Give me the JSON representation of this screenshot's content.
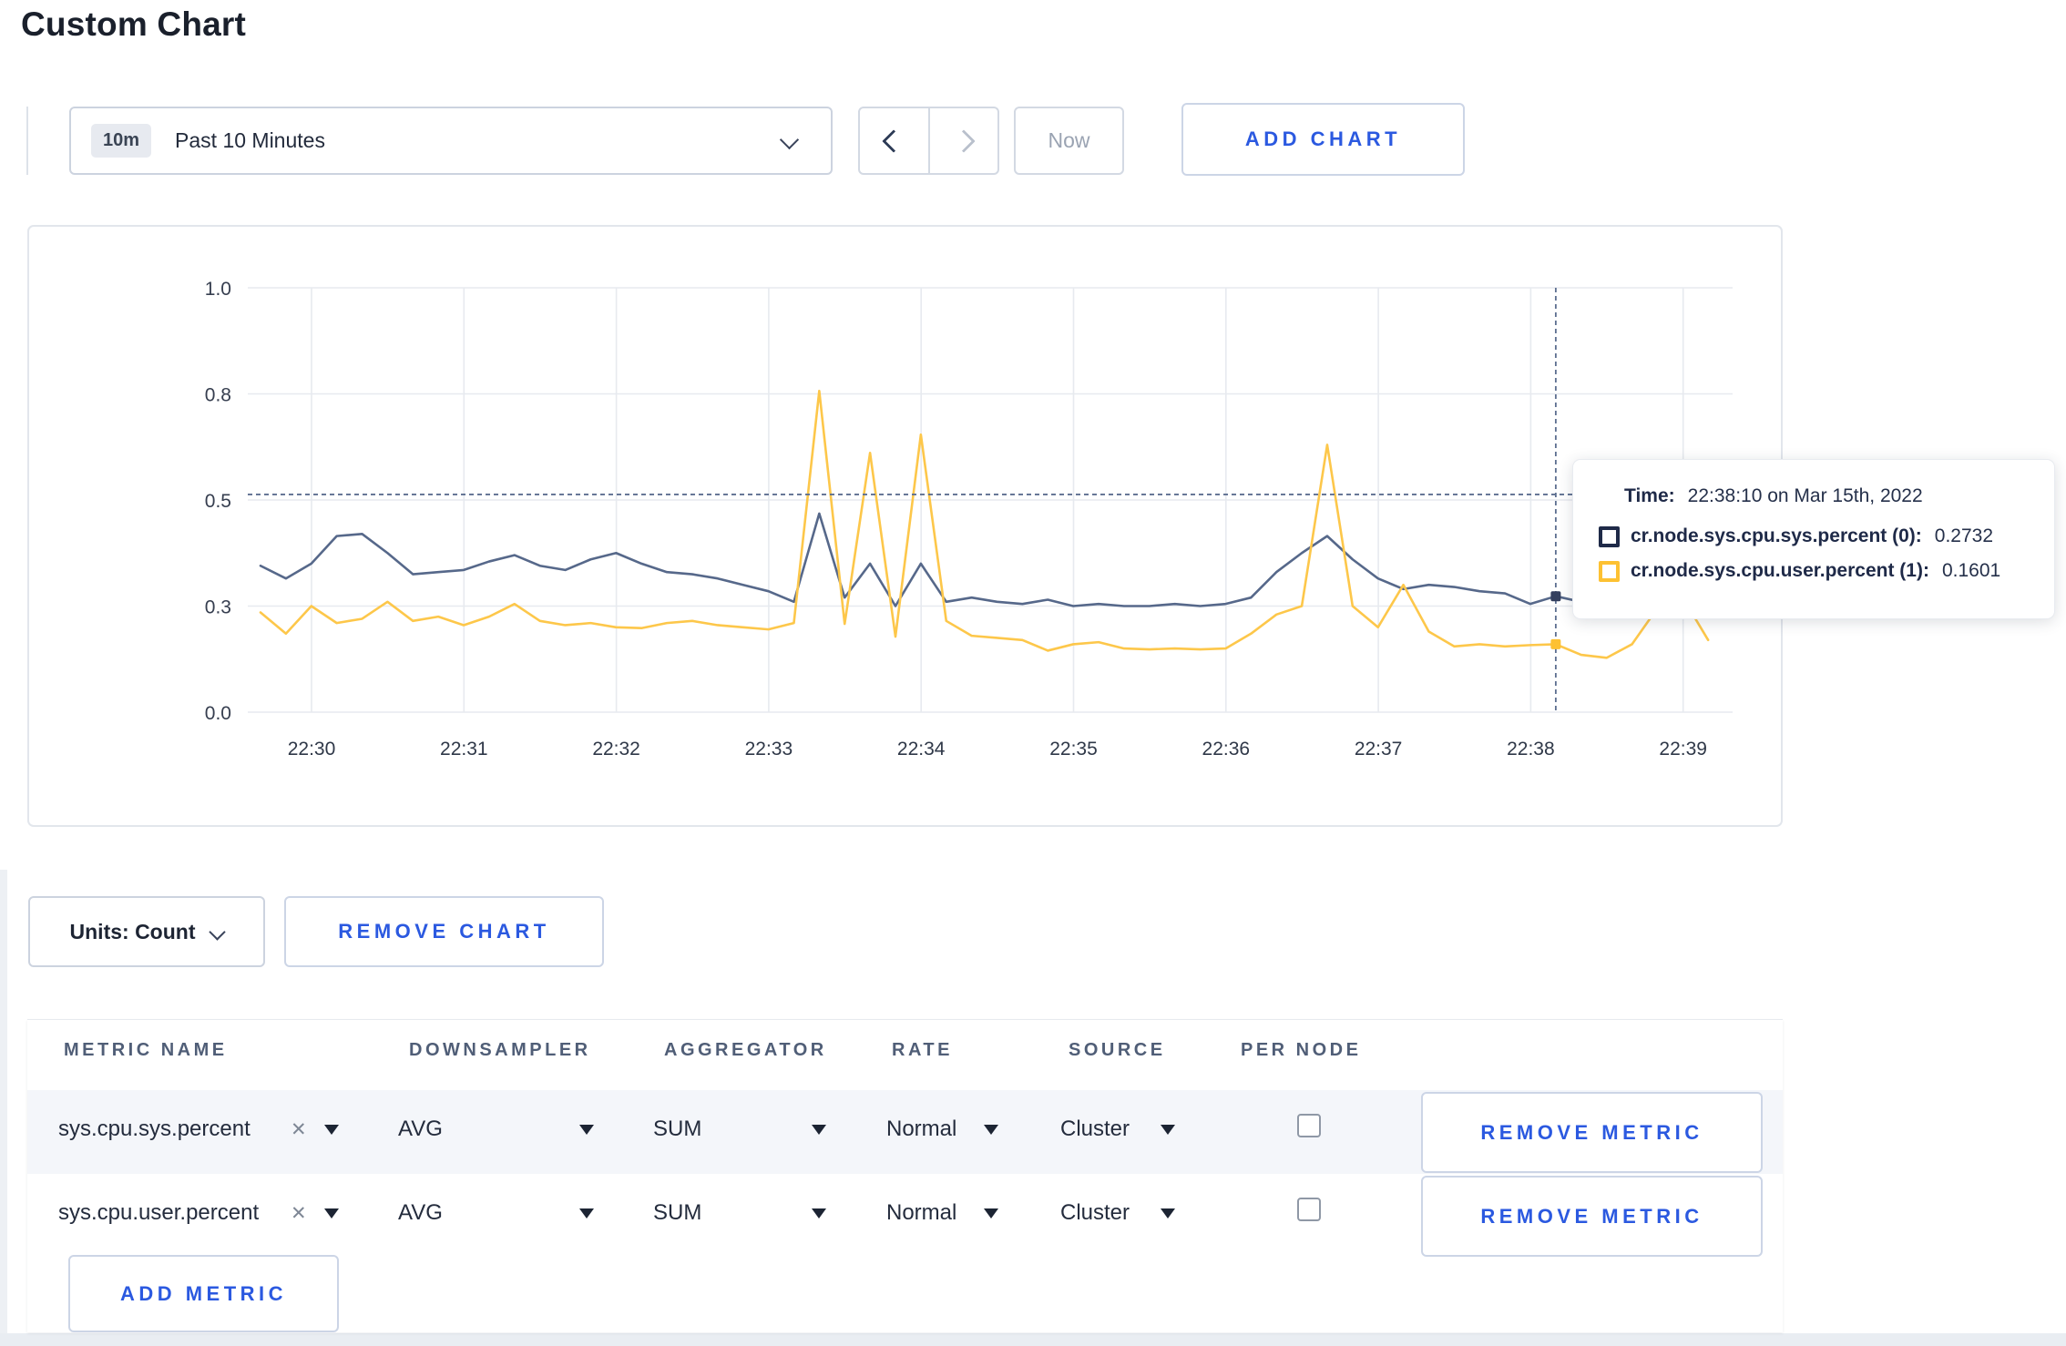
{
  "page": {
    "title": "Custom Chart"
  },
  "theme": {
    "accent_blue": "#2b59e0",
    "series_sys_color": "#56688a",
    "series_user_color": "#fdc74a"
  },
  "toolbar": {
    "time_badge": "10m",
    "time_label": "Past 10 Minutes",
    "now_label": "Now",
    "add_chart_label": "ADD CHART"
  },
  "chart": {
    "tooltip": {
      "time_label": "Time:",
      "time_value": "22:38:10 on Mar 15th, 2022",
      "rows": [
        {
          "label": "cr.node.sys.cpu.sys.percent (0):",
          "value": "0.2732",
          "color": "#1f2a48"
        },
        {
          "label": "cr.node.sys.cpu.user.percent (1):",
          "value": "0.1601",
          "color": "#fdc132"
        }
      ]
    }
  },
  "chart_data": {
    "type": "line",
    "title": "",
    "xlabel": "",
    "ylabel": "",
    "ylim": [
      0,
      1
    ],
    "grid": true,
    "legend_position": "none",
    "y_ticks": [
      {
        "value": 0.0,
        "label": "0.0"
      },
      {
        "value": 0.25,
        "label": "0.3"
      },
      {
        "value": 0.5,
        "label": "0.5"
      },
      {
        "value": 0.75,
        "label": "0.8"
      },
      {
        "value": 1.0,
        "label": "1.0"
      }
    ],
    "x_tick_labels": [
      "22:30",
      "22:31",
      "22:32",
      "22:33",
      "22:34",
      "22:35",
      "22:36",
      "22:37",
      "22:38",
      "22:39"
    ],
    "x_start": "22:29:40",
    "x_interval_seconds": 10,
    "x_times": [
      "22:29:40",
      "22:29:50",
      "22:30:00",
      "22:30:10",
      "22:30:20",
      "22:30:30",
      "22:30:40",
      "22:30:50",
      "22:31:00",
      "22:31:10",
      "22:31:20",
      "22:31:30",
      "22:31:40",
      "22:31:50",
      "22:32:00",
      "22:32:10",
      "22:32:20",
      "22:32:30",
      "22:32:40",
      "22:32:50",
      "22:33:00",
      "22:33:10",
      "22:33:20",
      "22:33:30",
      "22:33:40",
      "22:33:50",
      "22:34:00",
      "22:34:10",
      "22:34:20",
      "22:34:30",
      "22:34:40",
      "22:34:50",
      "22:35:00",
      "22:35:10",
      "22:35:20",
      "22:35:30",
      "22:35:40",
      "22:35:50",
      "22:36:00",
      "22:36:10",
      "22:36:20",
      "22:36:30",
      "22:36:40",
      "22:36:50",
      "22:37:00",
      "22:37:10",
      "22:37:20",
      "22:37:30",
      "22:37:40",
      "22:37:50",
      "22:38:00",
      "22:38:10",
      "22:38:20",
      "22:38:30",
      "22:38:40",
      "22:38:50",
      "22:39:00",
      "22:39:10"
    ],
    "series": [
      {
        "name": "cr.node.sys.cpu.sys.percent",
        "color": "#56688a",
        "dot_color": "#333f5e",
        "values": [
          0.345,
          0.315,
          0.35,
          0.415,
          0.42,
          0.375,
          0.325,
          0.33,
          0.335,
          0.355,
          0.37,
          0.345,
          0.335,
          0.36,
          0.375,
          0.35,
          0.33,
          0.325,
          0.315,
          0.3,
          0.285,
          0.26,
          0.468,
          0.27,
          0.35,
          0.25,
          0.35,
          0.26,
          0.27,
          0.26,
          0.255,
          0.265,
          0.25,
          0.255,
          0.25,
          0.25,
          0.255,
          0.25,
          0.255,
          0.27,
          0.33,
          0.375,
          0.415,
          0.36,
          0.315,
          0.29,
          0.3,
          0.295,
          0.285,
          0.28,
          0.255,
          0.2732,
          0.26,
          0.27,
          0.285,
          0.295,
          0.3,
          0.305
        ]
      },
      {
        "name": "cr.node.sys.cpu.user.percent",
        "color": "#fdc74a",
        "dot_color": "#fdc132",
        "values": [
          0.235,
          0.185,
          0.25,
          0.21,
          0.22,
          0.26,
          0.215,
          0.225,
          0.205,
          0.225,
          0.255,
          0.215,
          0.205,
          0.21,
          0.2,
          0.198,
          0.21,
          0.215,
          0.205,
          0.2,
          0.195,
          0.21,
          0.757,
          0.208,
          0.611,
          0.178,
          0.654,
          0.215,
          0.18,
          0.175,
          0.17,
          0.145,
          0.16,
          0.165,
          0.15,
          0.148,
          0.15,
          0.148,
          0.15,
          0.185,
          0.23,
          0.25,
          0.63,
          0.25,
          0.2,
          0.3,
          0.19,
          0.155,
          0.16,
          0.155,
          0.158,
          0.1601,
          0.135,
          0.128,
          0.16,
          0.245,
          0.27,
          0.17
        ]
      }
    ],
    "crosshair": {
      "index": 51,
      "time": "22:38:10",
      "hover_value": 0.513
    }
  },
  "units": {
    "label": "Units: Count",
    "remove_chart_label": "REMOVE CHART"
  },
  "metrics_table": {
    "headers": [
      "METRIC NAME",
      "DOWNSAMPLER",
      "AGGREGATOR",
      "RATE",
      "SOURCE",
      "PER NODE"
    ],
    "rows": [
      {
        "metric": "sys.cpu.sys.percent",
        "downsampler": "AVG",
        "aggregator": "SUM",
        "rate": "Normal",
        "source": "Cluster",
        "per_node_checked": false,
        "remove_label": "REMOVE METRIC"
      },
      {
        "metric": "sys.cpu.user.percent",
        "downsampler": "AVG",
        "aggregator": "SUM",
        "rate": "Normal",
        "source": "Cluster",
        "per_node_checked": false,
        "remove_label": "REMOVE METRIC"
      }
    ],
    "add_metric_label": "ADD METRIC"
  }
}
